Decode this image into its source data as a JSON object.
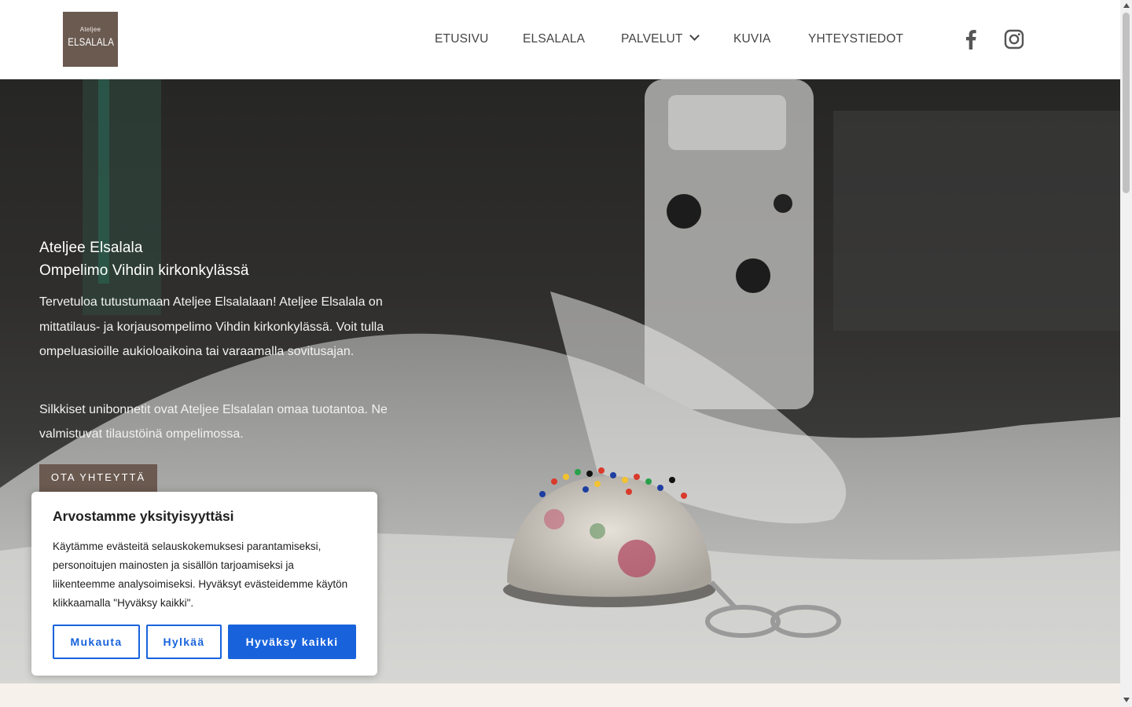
{
  "logo": {
    "small": "Ateljee",
    "big": "ELSALALA"
  },
  "nav": {
    "items": [
      {
        "label": "ETUSIVU"
      },
      {
        "label": "ELSALALA"
      },
      {
        "label": "PALVELUT"
      },
      {
        "label": "KUVIA"
      },
      {
        "label": "YHTEYSTIEDOT"
      }
    ]
  },
  "social": {
    "icons": [
      "facebook-icon",
      "instagram-icon"
    ]
  },
  "hero": {
    "title_line1": "Ateljee Elsalala",
    "title_line2": "Ompelimo Vihdin kirkonkylässä",
    "paragraph1": "Tervetuloa tutustumaan Ateljee Elsalalaan! Ateljee Elsalala on mittatilaus- ja korjausompelimo Vihdin kirkonkylässä. Voit tulla ompeluasioille aukioloaikoina tai varaamalla sovitusajan.",
    "paragraph2": "Silkkiset unibonnetit ovat Ateljee Elsalalan omaa tuotantoa. Ne valmistuvat tilaustöinä ompelimossa.",
    "cta_label": "OTA YHTEYTTÄ"
  },
  "cookie": {
    "title": "Arvostamme yksityisyyttäsi",
    "text": "Käytämme evästeitä selauskokemuksesi parantamiseksi, personoitujen mainosten ja sisällön tarjoamiseksi ja liikenteemme analysoimiseksi. Hyväksyt evästeidemme käytön klikkaamalla \"Hyväksy kaikki\".",
    "customize_label": "Mukauta",
    "reject_label": "Hylkää",
    "accept_label": "Hyväksy kaikki"
  },
  "colors": {
    "brand": "#6b5a50",
    "accent_blue": "#1863dc",
    "nav_text": "#444444",
    "bottom_strip": "#f7f1ec"
  }
}
